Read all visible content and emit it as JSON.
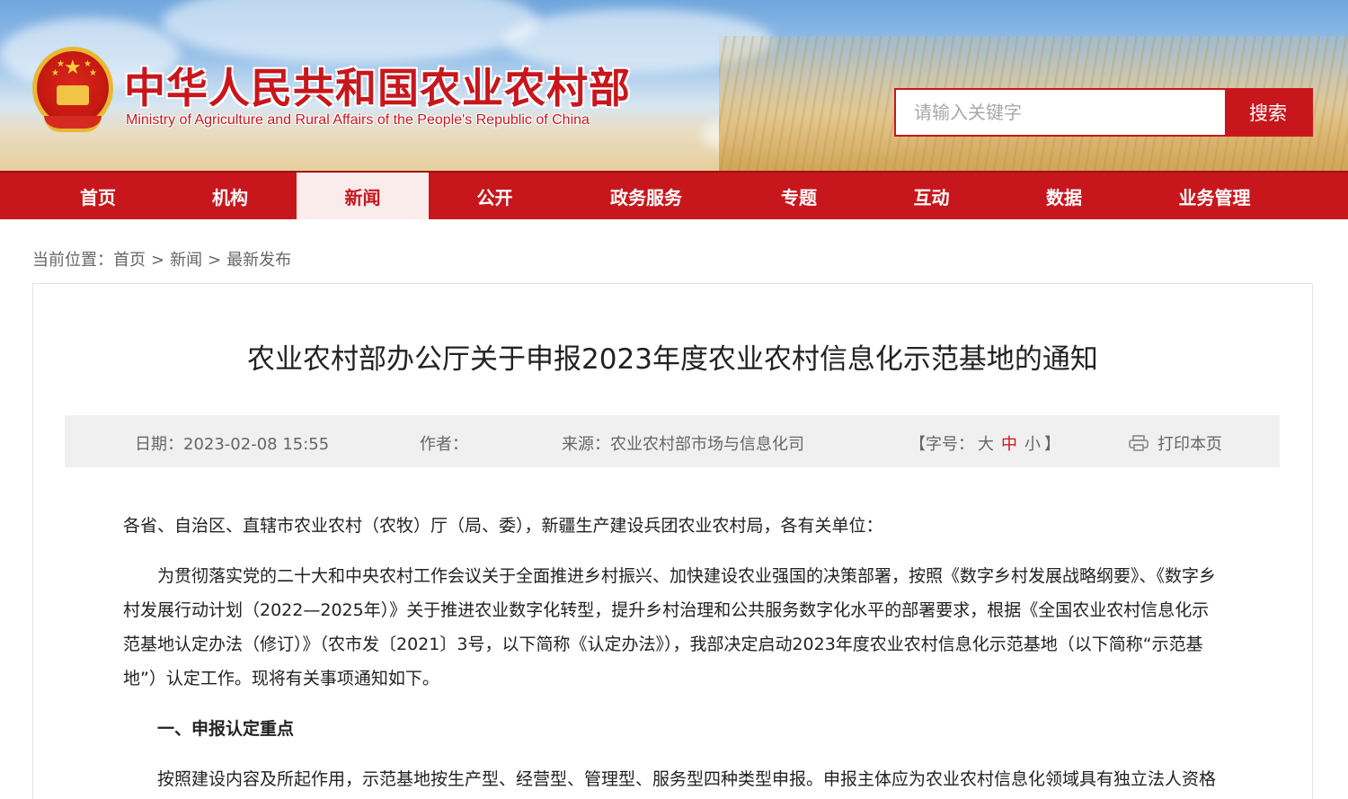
{
  "header": {
    "site_title": "中华人民共和国农业农村部",
    "site_subtitle": "Ministry of Agriculture and Rural Affairs of the People's Republic of China",
    "search_placeholder": "请输入关键字",
    "search_button": "搜索"
  },
  "nav": {
    "items": [
      {
        "label": "首页"
      },
      {
        "label": "机构"
      },
      {
        "label": "新闻",
        "active": true
      },
      {
        "label": "公开"
      },
      {
        "label": "政务服务"
      },
      {
        "label": "专题"
      },
      {
        "label": "互动"
      },
      {
        "label": "数据"
      },
      {
        "label": "业务管理"
      }
    ]
  },
  "breadcrumb": {
    "prefix": "当前位置：",
    "items": [
      "首页",
      "新闻",
      "最新发布"
    ],
    "separator": ">"
  },
  "article": {
    "title": "农业农村部办公厅关于申报2023年度农业农村信息化示范基地的通知",
    "meta": {
      "date": "日期：2023-02-08 15:55",
      "author": "作者：",
      "source": "来源：农业农村部市场与信息化司",
      "font_prefix": "【字号：",
      "font_large": "大",
      "font_medium": "中",
      "font_small": "小",
      "font_suffix": "】",
      "print": "打印本页"
    },
    "salutation": "各省、自治区、直辖市农业农村（农牧）厅（局、委），新疆生产建设兵团农业农村局，各有关单位：",
    "paragraph1": "为贯彻落实党的二十大和中央农村工作会议关于全面推进乡村振兴、加快建设农业强国的决策部署，按照《数字乡村发展战略纲要》、《数字乡村发展行动计划（2022—2025年）》关于推进农业数字化转型，提升乡村治理和公共服务数字化水平的部署要求，根据《全国农业农村信息化示范基地认定办法（修订）》（农市发〔2021〕3号，以下简称《认定办法》），我部决定启动2023年度农业农村信息化示范基地（以下简称“示范基地”）认定工作。现将有关事项通知如下。",
    "section1_heading": "一、申报认定重点",
    "paragraph2": "按照建设内容及所起作用，示范基地按生产型、经营型、管理型、服务型四种类型申报。申报主体应为农业农村信息化领域具有独立法人资格"
  },
  "colors": {
    "brand_red": "#c8161d",
    "nav_active_bg": "#fbecec",
    "meta_bg": "#f0f0f0"
  }
}
